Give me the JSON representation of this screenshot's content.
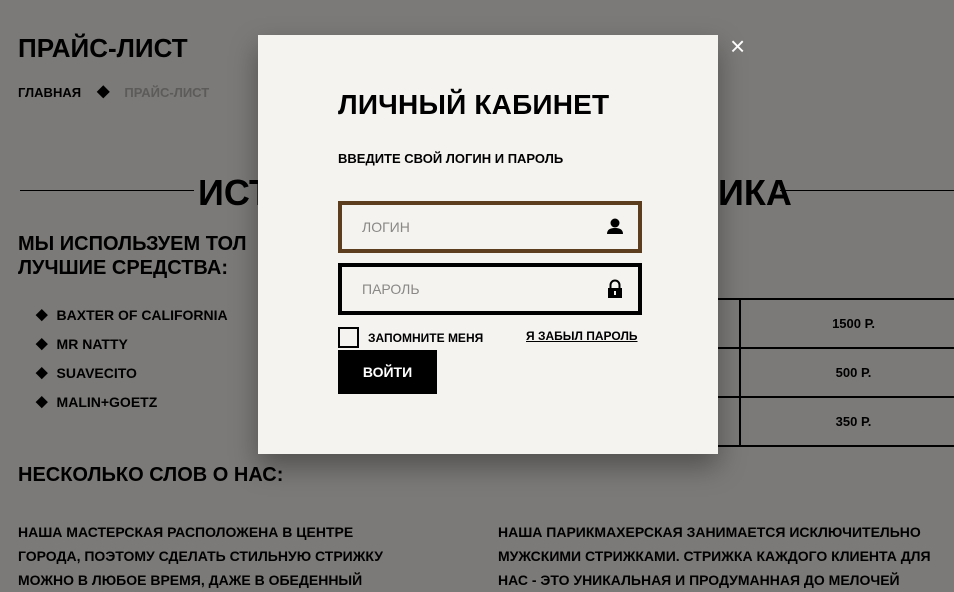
{
  "page": {
    "title": "ПРАЙС-ЛИСТ",
    "breadcrumb": {
      "home": "ГЛАВНАЯ",
      "separator": "◆",
      "current": "ПРАЙС-ЛИСТ"
    },
    "section_heading": {
      "left": "ИСТ",
      "right": "ИКА"
    },
    "products": {
      "title_line1": "МЫ ИСПОЛЬЗУЕМ ТОЛ",
      "title_line2": "ЛУЧШИЕ СРЕДСТВА:",
      "items": [
        "BAXTER OF CALIFORNIA",
        "MR NATTY",
        "SUAVECITO",
        "MALIN+GOETZ"
      ]
    },
    "price_table": {
      "rows": [
        "1500 Р.",
        "500 Р.",
        "350 Р."
      ]
    },
    "about": {
      "title": "НЕСКОЛЬКО СЛОВ О НАС:",
      "left_lines": [
        "НАША МАСТЕРСКАЯ РАСПОЛОЖЕНА В ЦЕНТРЕ",
        "ГОРОДА, ПОЭТОМУ СДЕЛАТЬ СТИЛЬНУЮ СТРИЖКУ",
        "МОЖНО В ЛЮБОЕ ВРЕМЯ, ДАЖЕ В ОБЕДЕННЫЙ"
      ],
      "right_lines": [
        "НАША ПАРИКМАХЕРСКАЯ ЗАНИМАЕТСЯ ИСКЛЮЧИТЕЛЬНО",
        "МУЖСКИМИ СТРИЖКАМИ. СТРИЖКА КАЖДОГО КЛИЕНТА ДЛЯ",
        "НАС - ЭТО УНИКАЛЬНАЯ И ПРОДУМАННАЯ ДО МЕЛОЧЕЙ"
      ]
    }
  },
  "modal": {
    "close": "×",
    "title": "ЛИЧНЫЙ КАБИНЕТ",
    "subtitle": "ВВЕДИТЕ СВОЙ ЛОГИН И ПАРОЛЬ",
    "login": {
      "placeholder": "ЛОГИН",
      "value": "",
      "icon": "user-icon"
    },
    "password": {
      "placeholder": "ПАРОЛЬ",
      "value": "",
      "icon": "lock-icon"
    },
    "remember_label": "ЗАПОМНИТЕ МЕНЯ",
    "remember_checked": false,
    "forgot_label": "Я ЗАБЫЛ ПАРОЛЬ",
    "submit_label": "ВОЙТИ"
  },
  "colors": {
    "overlay_background": "#7c7a78",
    "modal_background": "#f5f3f0",
    "active_field_border": "#5c3d1e",
    "button_background": "#000000",
    "button_text": "#ffffff"
  }
}
